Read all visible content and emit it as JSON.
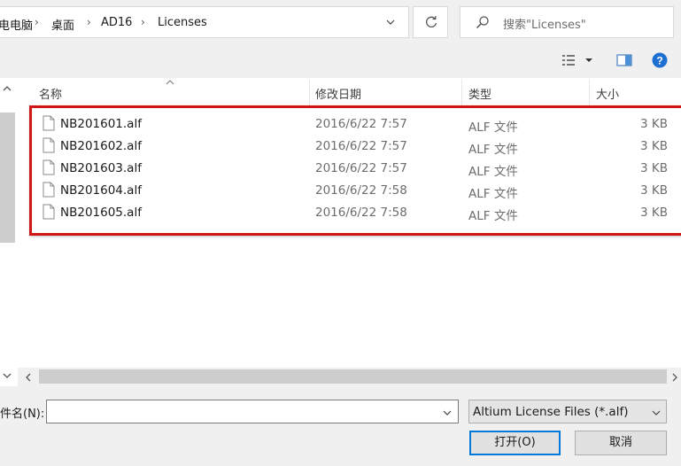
{
  "breadcrumb": {
    "items": [
      "电电脑",
      "桌面",
      "AD16",
      "Licenses"
    ]
  },
  "search": {
    "placeholder": "搜索\"Licenses\""
  },
  "columns": {
    "name": "名称",
    "date": "修改日期",
    "type": "类型",
    "size": "大小"
  },
  "files": [
    {
      "name": "NB201601.alf",
      "date": "2016/6/22 7:57",
      "type": "ALF 文件",
      "size": "3 KB"
    },
    {
      "name": "NB201602.alf",
      "date": "2016/6/22 7:57",
      "type": "ALF 文件",
      "size": "3 KB"
    },
    {
      "name": "NB201603.alf",
      "date": "2016/6/22 7:57",
      "type": "ALF 文件",
      "size": "3 KB"
    },
    {
      "name": "NB201604.alf",
      "date": "2016/6/22 7:58",
      "type": "ALF 文件",
      "size": "3 KB"
    },
    {
      "name": "NB201605.alf",
      "date": "2016/6/22 7:58",
      "type": "ALF 文件",
      "size": "3 KB"
    }
  ],
  "bottom": {
    "filename_label": "件名(N):",
    "filename_value": "",
    "filter": "Altium License Files (*.alf)",
    "open_label": "打开(O)",
    "cancel_label": "取消"
  },
  "colors": {
    "accent": "#0078d7",
    "highlight": "#d01515",
    "help": "#1e6fd0"
  },
  "icons": {
    "refresh": "refresh-icon",
    "search": "search-icon",
    "view": "view-list-icon",
    "preview": "preview-pane-icon",
    "help": "help-icon",
    "file": "file-icon"
  }
}
